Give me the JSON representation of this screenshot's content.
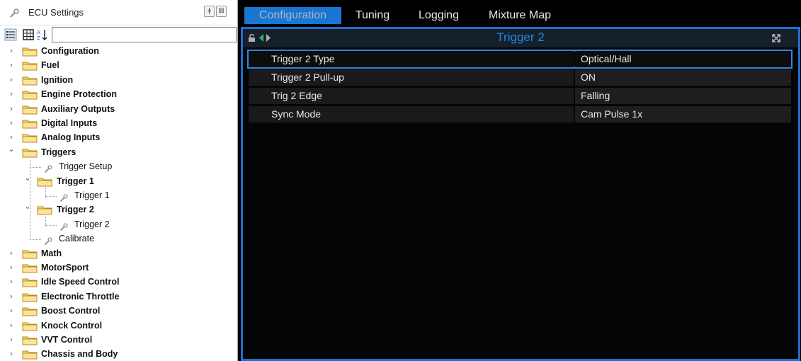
{
  "panel": {
    "title": "ECU Settings",
    "pin_glyph": "ǂ",
    "close_glyph": "⊠",
    "search": {
      "value": "",
      "placeholder": ""
    }
  },
  "tree": {
    "top": [
      {
        "label": "Configuration"
      },
      {
        "label": "Fuel"
      },
      {
        "label": "Ignition"
      },
      {
        "label": "Engine Protection"
      },
      {
        "label": "Auxiliary Outputs"
      },
      {
        "label": "Digital Inputs"
      },
      {
        "label": "Analog Inputs"
      },
      {
        "label": "Triggers"
      }
    ],
    "triggers_children": {
      "trigger_setup": "Trigger Setup",
      "trigger1_folder": "Trigger 1",
      "trigger1_leaf": "Trigger 1",
      "trigger2_folder": "Trigger 2",
      "trigger2_leaf": "Trigger 2",
      "calibrate": "Calibrate"
    },
    "bottom": [
      {
        "label": "Math"
      },
      {
        "label": "MotorSport"
      },
      {
        "label": "Idle Speed Control"
      },
      {
        "label": "Electronic Throttle"
      },
      {
        "label": "Boost Control"
      },
      {
        "label": "Knock Control"
      },
      {
        "label": "VVT Control"
      },
      {
        "label": "Chassis and Body"
      }
    ]
  },
  "tabs": [
    {
      "label": "Configuration",
      "active": true
    },
    {
      "label": "Tuning",
      "active": false
    },
    {
      "label": "Logging",
      "active": false
    },
    {
      "label": "Mixture Map",
      "active": false
    }
  ],
  "content": {
    "title": "Trigger 2",
    "properties": [
      {
        "name": "Trigger 2 Type",
        "value": "Optical/Hall",
        "selected": true
      },
      {
        "name": "Trigger 2 Pull-up",
        "value": "ON",
        "selected": false
      },
      {
        "name": "Trig 2 Edge",
        "value": "Falling",
        "selected": false
      },
      {
        "name": "Sync Mode",
        "value": "Cam Pulse 1x",
        "selected": false
      }
    ]
  },
  "colors": {
    "accent": "#1976d2",
    "frame_border": "#1f6fd1",
    "title_text": "#1e88e5",
    "folder_fill": "#f7d774",
    "folder_stroke": "#b38b1c"
  },
  "icons": {
    "panel": "wrench-icon",
    "tree_folder": "folder-icon",
    "tree_leaf": "wrench-icon",
    "header_lock": "lock-icon",
    "header_prev": "arrow-left-icon",
    "header_next": "arrow-right-icon",
    "header_expand": "expand-icon"
  }
}
